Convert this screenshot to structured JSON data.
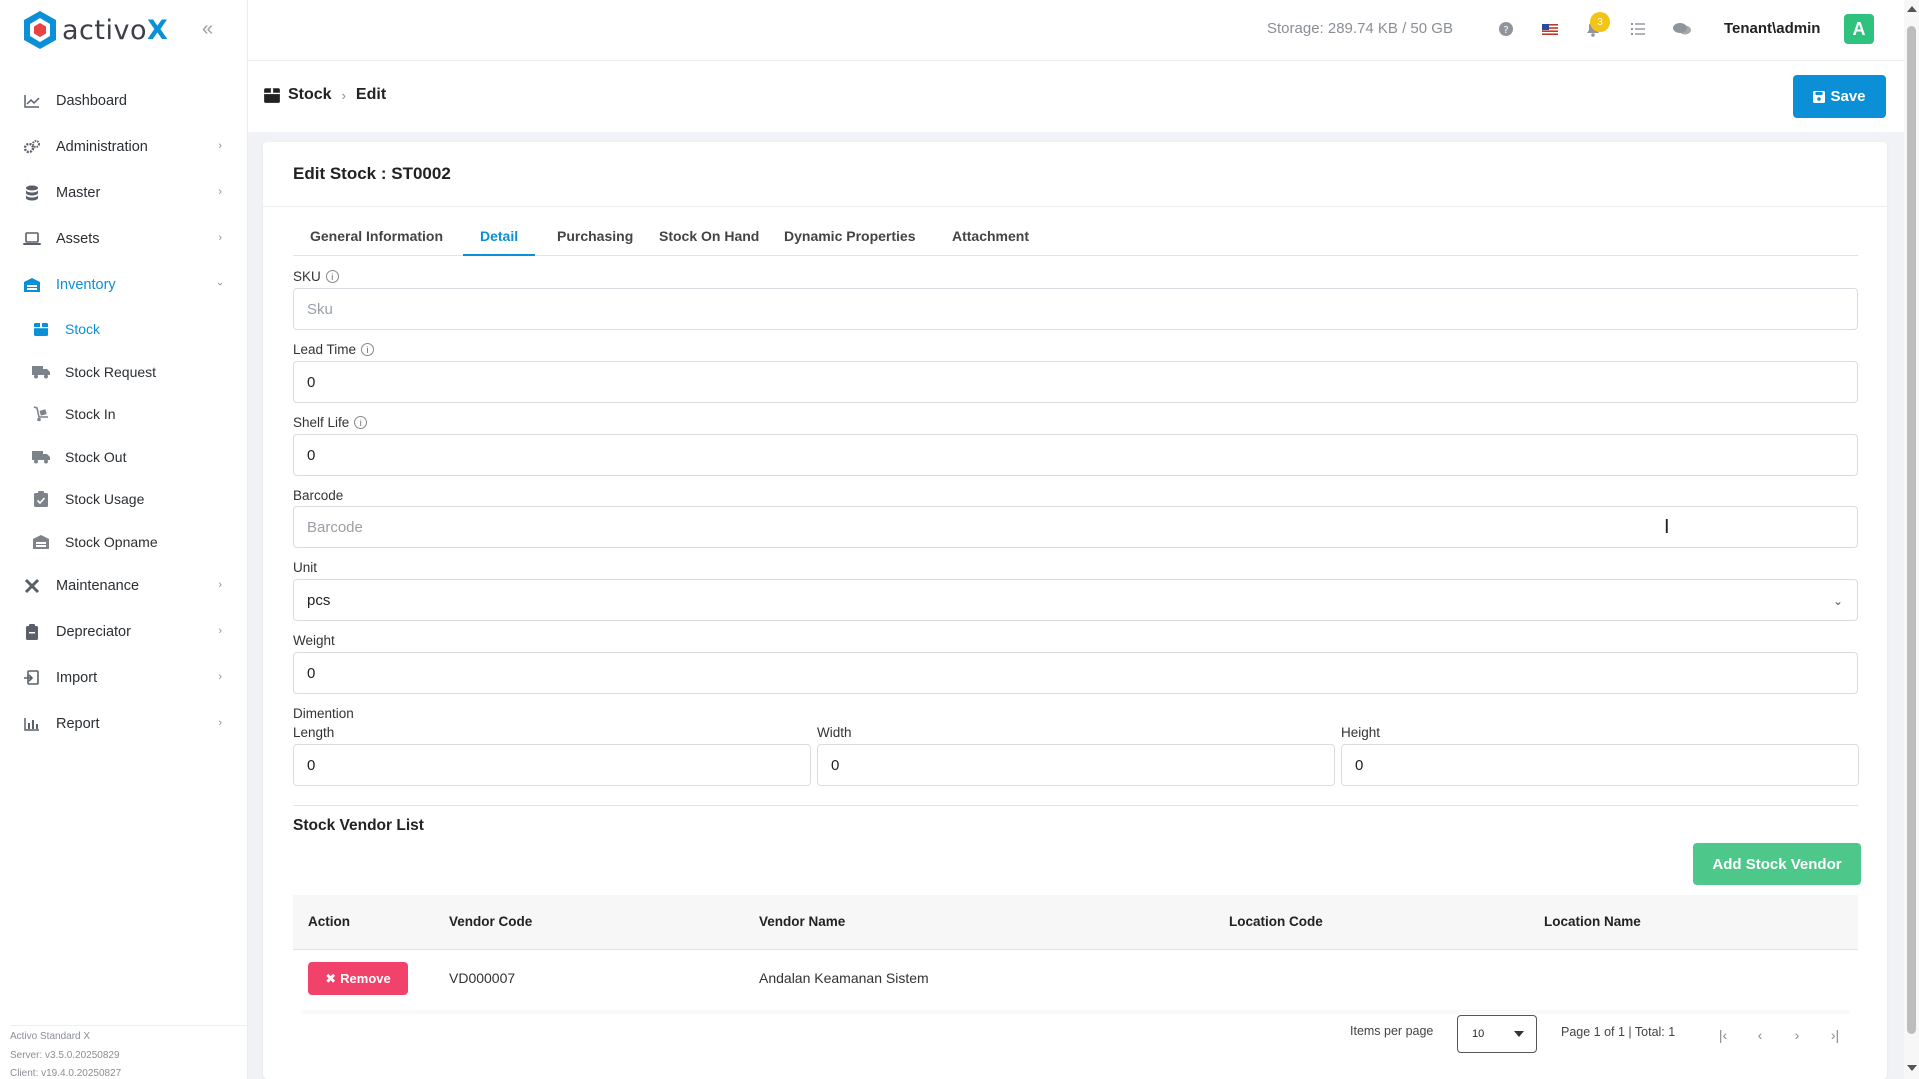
{
  "app": {
    "logo_prefix": "activo",
    "logo_suffix": "X",
    "brand_color": "#0b8fd6"
  },
  "sidebar": {
    "items": [
      {
        "label": "Dashboard",
        "icon": "chart-line-icon"
      },
      {
        "label": "Administration",
        "icon": "gears-icon"
      },
      {
        "label": "Master",
        "icon": "database-icon"
      },
      {
        "label": "Assets",
        "icon": "laptop-icon"
      },
      {
        "label": "Inventory",
        "icon": "warehouse-icon",
        "expanded": true
      },
      {
        "label": "Maintenance",
        "icon": "tools-icon"
      },
      {
        "label": "Depreciator",
        "icon": "clipboard-icon"
      },
      {
        "label": "Import",
        "icon": "import-icon"
      },
      {
        "label": "Report",
        "icon": "bar-chart-icon"
      }
    ],
    "inventory_sub": [
      {
        "label": "Stock",
        "icon": "box-icon",
        "active": true
      },
      {
        "label": "Stock Request",
        "icon": "truck-icon"
      },
      {
        "label": "Stock In",
        "icon": "dolly-icon"
      },
      {
        "label": "Stock Out",
        "icon": "truck-out-icon"
      },
      {
        "label": "Stock Usage",
        "icon": "clipboard-check-icon"
      },
      {
        "label": "Stock Opname",
        "icon": "warehouse-icon"
      }
    ],
    "version": {
      "product": "Activo Standard X",
      "server": "Server: v3.5.0.20250829",
      "client": "Client: v19.4.0.20250827"
    }
  },
  "topbar": {
    "storage": "Storage: 289.74 KB / 50 GB",
    "notification_count": "3",
    "user": "Tenant\\admin",
    "avatar_letter": "A"
  },
  "breadcrumb": {
    "parent": "Stock",
    "current": "Edit"
  },
  "toolbar": {
    "save_label": "Save"
  },
  "form": {
    "title": "Edit Stock : ST0002",
    "tabs": [
      "General Information",
      "Detail",
      "Purchasing",
      "Stock On Hand",
      "Dynamic Properties",
      "Attachment"
    ],
    "active_tab": "Detail",
    "sku": {
      "label": "SKU",
      "value": "",
      "placeholder": "Sku"
    },
    "lead_time": {
      "label": "Lead Time",
      "value": "0"
    },
    "shelf_life": {
      "label": "Shelf Life",
      "value": "0"
    },
    "barcode": {
      "label": "Barcode",
      "value": "",
      "placeholder": "Barcode"
    },
    "unit": {
      "label": "Unit",
      "value": "pcs"
    },
    "weight": {
      "label": "Weight",
      "value": "0"
    },
    "dimension": {
      "label": "Dimention",
      "length": {
        "label": "Length",
        "value": "0"
      },
      "width": {
        "label": "Width",
        "value": "0"
      },
      "height": {
        "label": "Height",
        "value": "0"
      }
    }
  },
  "vendor_list": {
    "title": "Stock Vendor List",
    "add_label": "Add Stock Vendor",
    "columns": [
      "Action",
      "Vendor Code",
      "Vendor Name",
      "Location Code",
      "Location Name"
    ],
    "rows": [
      {
        "action": "Remove",
        "vendor_code": "VD000007",
        "vendor_name": "Andalan Keamanan Sistem",
        "location_code": "",
        "location_name": ""
      }
    ],
    "pagination": {
      "items_per_page_label": "Items per page",
      "items_per_page": "10",
      "summary": "Page 1 of 1 | Total: 1"
    }
  }
}
